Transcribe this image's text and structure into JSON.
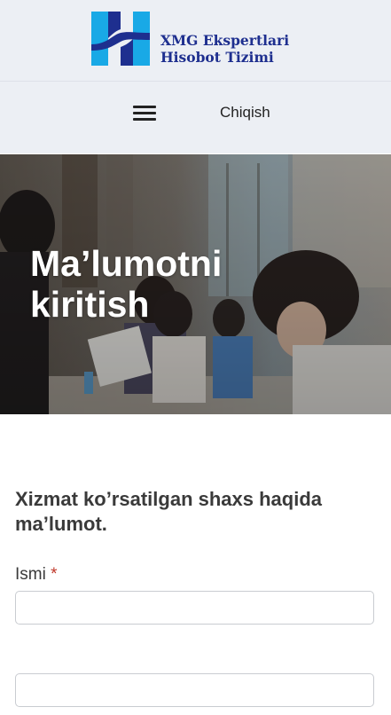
{
  "header": {
    "logo_line1": "XMG Ekspertlari",
    "logo_line2": "Hisobot Tizimi",
    "brand_colors": {
      "blue": "#1e2f8f",
      "cyan": "#19a9e6"
    }
  },
  "nav": {
    "menu_icon": "hamburger-icon",
    "logout_label": "Chiqish"
  },
  "hero": {
    "title": "Ma’lumotni kiritish"
  },
  "form": {
    "section_heading": "Xizmat ko’rsatilgan shaxs haqida ma’lumot.",
    "fields": [
      {
        "label": "Ismi",
        "required_mark": "*",
        "value": "",
        "placeholder": ""
      },
      {
        "label": "",
        "value": ""
      }
    ]
  }
}
